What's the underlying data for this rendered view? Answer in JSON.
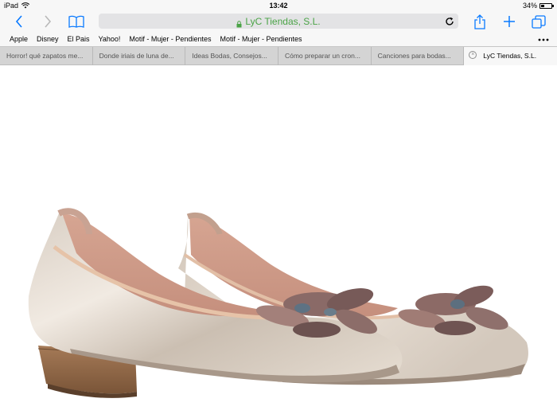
{
  "status": {
    "device": "iPad",
    "time": "13:42",
    "battery_text": "34%",
    "battery_level": 0.34
  },
  "nav": {
    "back_icon": "chevron-left-icon",
    "forward_icon": "chevron-right-icon",
    "bookmarks_icon": "book-icon",
    "address": "LyC Tiendas, S.L.",
    "share_icon": "share-icon",
    "add_icon": "plus-icon",
    "tabs_icon": "tabs-icon",
    "accent": "#0a7aff",
    "secure_color": "#4aa346"
  },
  "bookmarks": [
    {
      "label": "Apple"
    },
    {
      "label": "Disney"
    },
    {
      "label": "El Pais"
    },
    {
      "label": "Yahoo!"
    },
    {
      "label": "Motif - Mujer - Pendientes"
    },
    {
      "label": "Motif - Mujer - Pendientes"
    }
  ],
  "tabs": [
    {
      "label": "Horror! qué zapatos me..."
    },
    {
      "label": "Donde iriais de luna de..."
    },
    {
      "label": "Ideas Bodas, Consejos..."
    },
    {
      "label": "Cómo preparar un cron..."
    },
    {
      "label": "Canciones para bodas..."
    },
    {
      "label": "LyC Tiendas, S.L."
    }
  ],
  "content": {
    "image": "metallic-ballet-flats-with-flower"
  }
}
